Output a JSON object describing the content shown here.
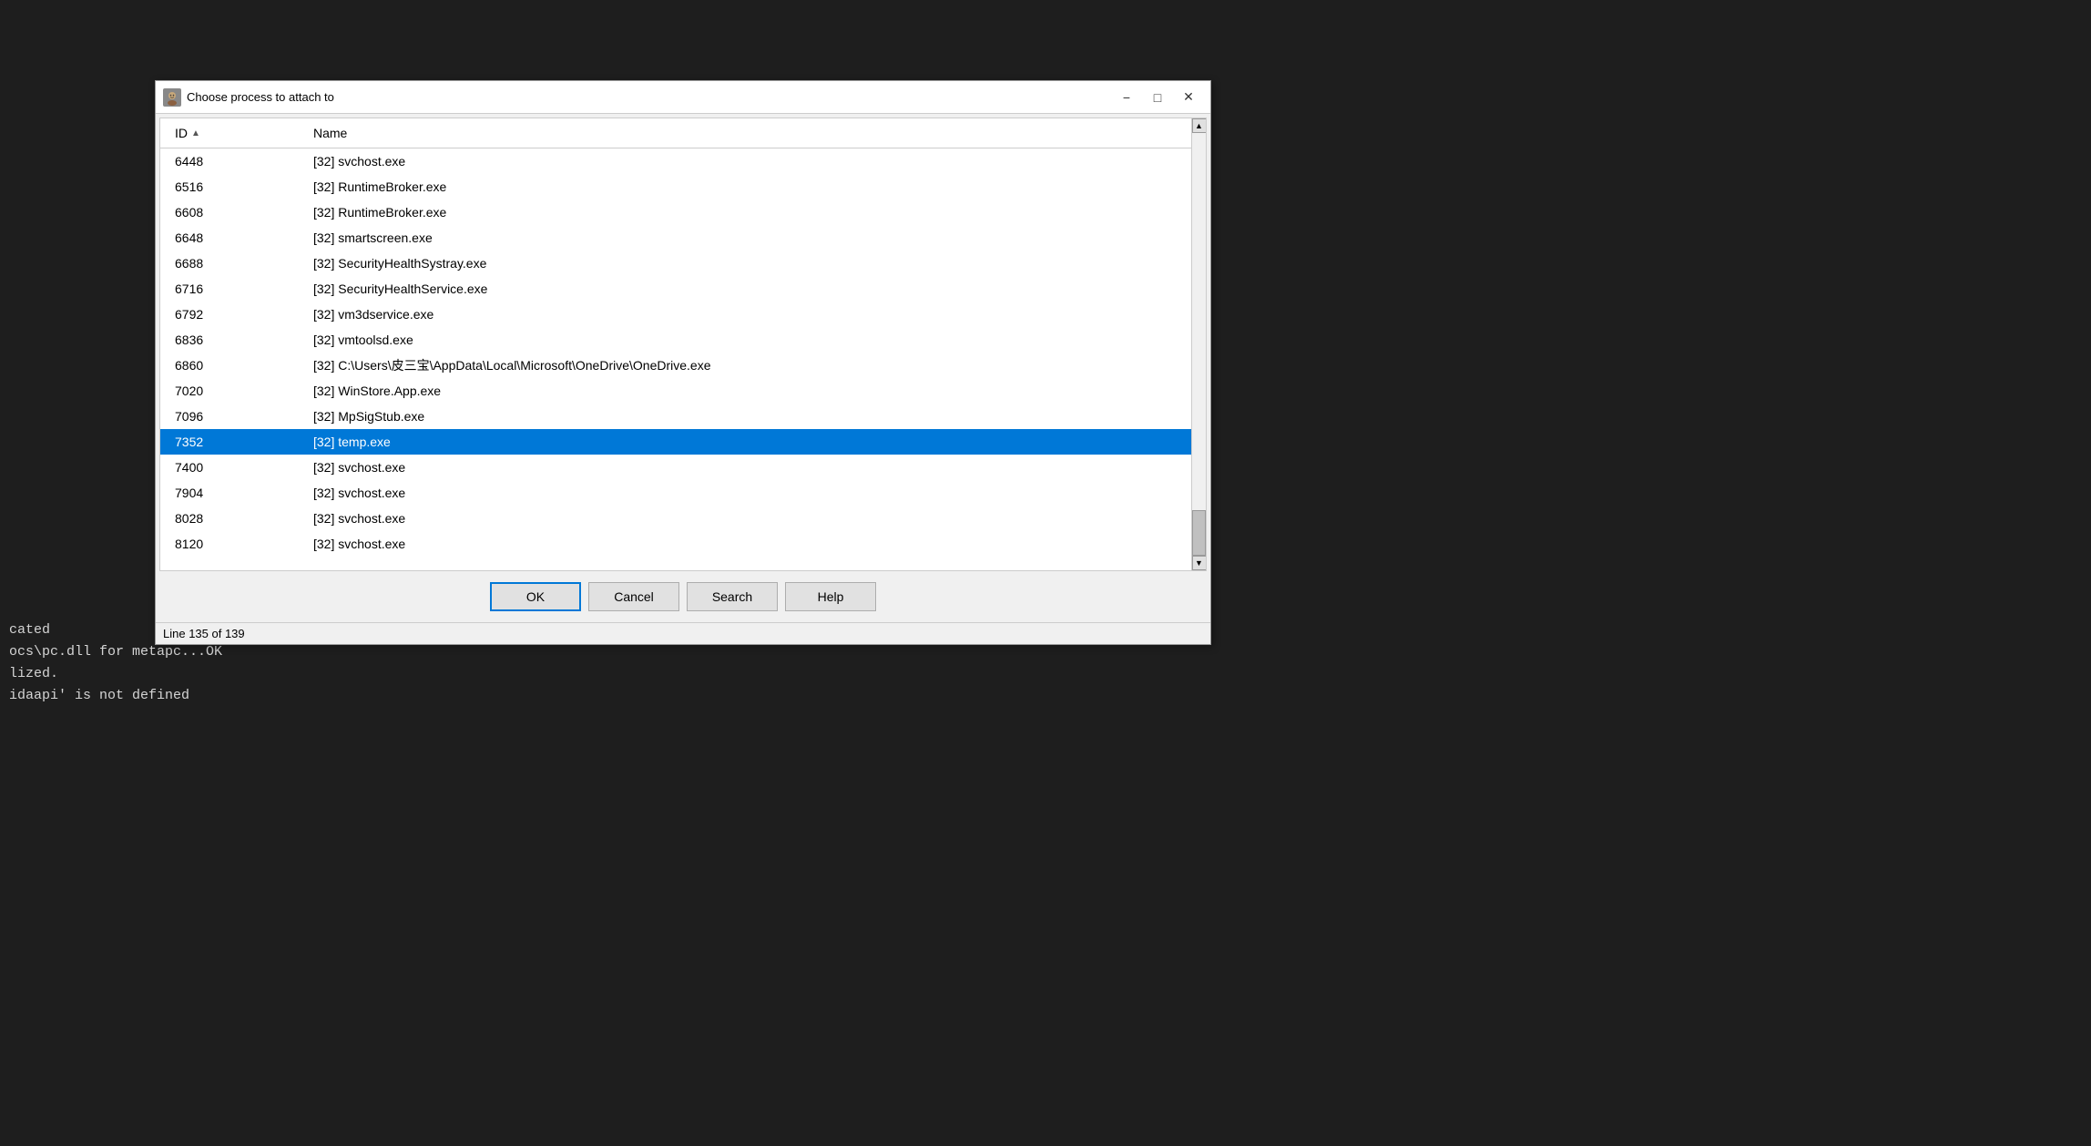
{
  "terminal": {
    "lines": [
      "cated",
      "",
      "ocs\\pc.dll for metapc...OK",
      "lized.",
      "idaapi' is not defined"
    ]
  },
  "dialog": {
    "title": "Choose process to attach to",
    "columns": {
      "id": "ID",
      "name": "Name"
    },
    "processes": [
      {
        "id": "6448",
        "name": "[32] svchost.exe",
        "selected": false
      },
      {
        "id": "6516",
        "name": "[32] RuntimeBroker.exe",
        "selected": false
      },
      {
        "id": "6608",
        "name": "[32] RuntimeBroker.exe",
        "selected": false
      },
      {
        "id": "6648",
        "name": "[32] smartscreen.exe",
        "selected": false
      },
      {
        "id": "6688",
        "name": "[32] SecurityHealthSystray.exe",
        "selected": false
      },
      {
        "id": "6716",
        "name": "[32] SecurityHealthService.exe",
        "selected": false
      },
      {
        "id": "6792",
        "name": "[32] vm3dservice.exe",
        "selected": false
      },
      {
        "id": "6836",
        "name": "[32] vmtoolsd.exe",
        "selected": false
      },
      {
        "id": "6860",
        "name": "[32] C:\\Users\\皮三宝\\AppData\\Local\\Microsoft\\OneDrive\\OneDrive.exe",
        "selected": false
      },
      {
        "id": "7020",
        "name": "[32] WinStore.App.exe",
        "selected": false
      },
      {
        "id": "7096",
        "name": "[32] MpSigStub.exe",
        "selected": false
      },
      {
        "id": "7352",
        "name": "[32] temp.exe",
        "selected": true
      },
      {
        "id": "7400",
        "name": "[32] svchost.exe",
        "selected": false
      },
      {
        "id": "7904",
        "name": "[32] svchost.exe",
        "selected": false
      },
      {
        "id": "8028",
        "name": "[32] svchost.exe",
        "selected": false
      },
      {
        "id": "8120",
        "name": "[32] svchost.exe",
        "selected": false
      }
    ],
    "buttons": {
      "ok": "OK",
      "cancel": "Cancel",
      "search": "Search",
      "help": "Help"
    },
    "status": "Line 135 of 139"
  }
}
